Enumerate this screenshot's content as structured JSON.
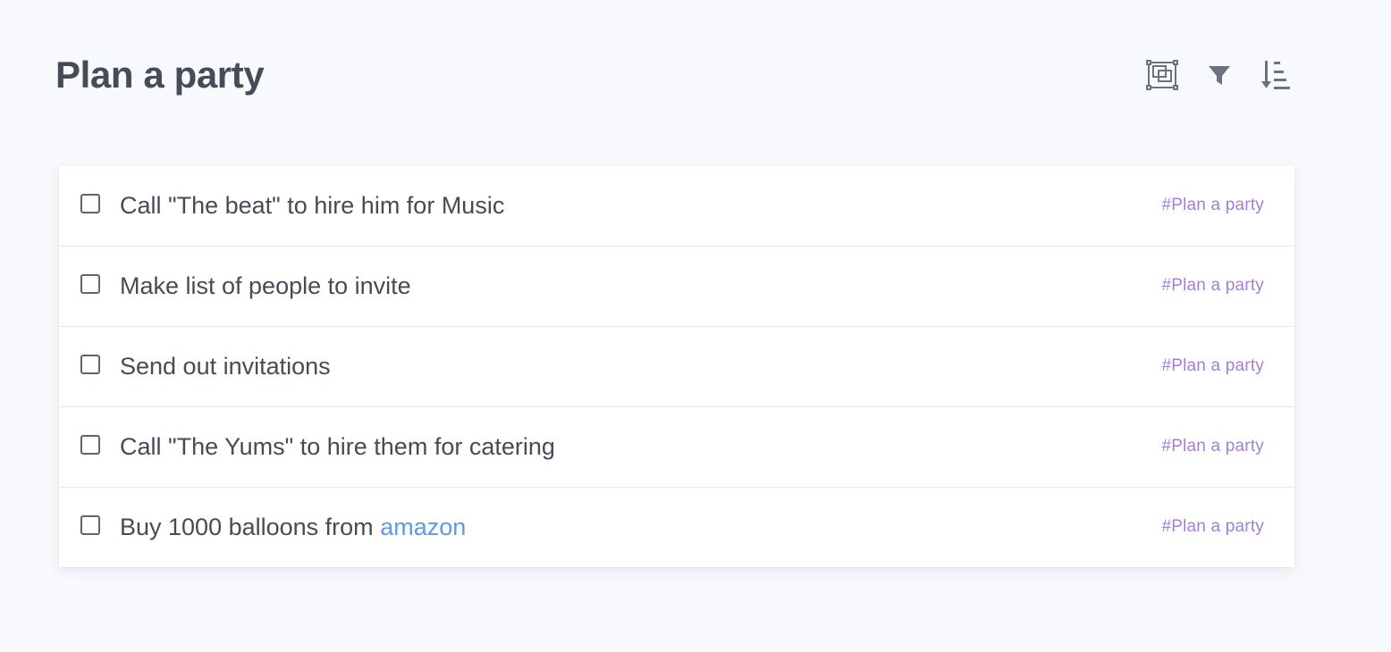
{
  "page": {
    "title": "Plan a party"
  },
  "toolbar": {
    "icons": [
      "view-layout-icon",
      "filter-icon",
      "sort-icon"
    ],
    "icon_color": "#6b7383"
  },
  "tasks": [
    {
      "parts": [
        "Call \"The beat\" to hire him for Music"
      ],
      "link": "",
      "tag": "#Plan a party",
      "checked": false
    },
    {
      "parts": [
        "Make list of people to invite"
      ],
      "link": "",
      "tag": "#Plan a party",
      "checked": false
    },
    {
      "parts": [
        "Send out invitations"
      ],
      "link": "",
      "tag": "#Plan a party",
      "checked": false
    },
    {
      "parts": [
        "Call \"The Yums\" to hire them for catering"
      ],
      "link": "",
      "tag": "#Plan a party",
      "checked": false
    },
    {
      "parts": [
        "Buy 1000 balloons from "
      ],
      "link": "amazon",
      "tag": "#Plan a party",
      "checked": false
    }
  ],
  "colors": {
    "background": "#f8f9fd",
    "tag": "#a27fd8",
    "link": "#5b9be6",
    "text": "#454c58"
  }
}
